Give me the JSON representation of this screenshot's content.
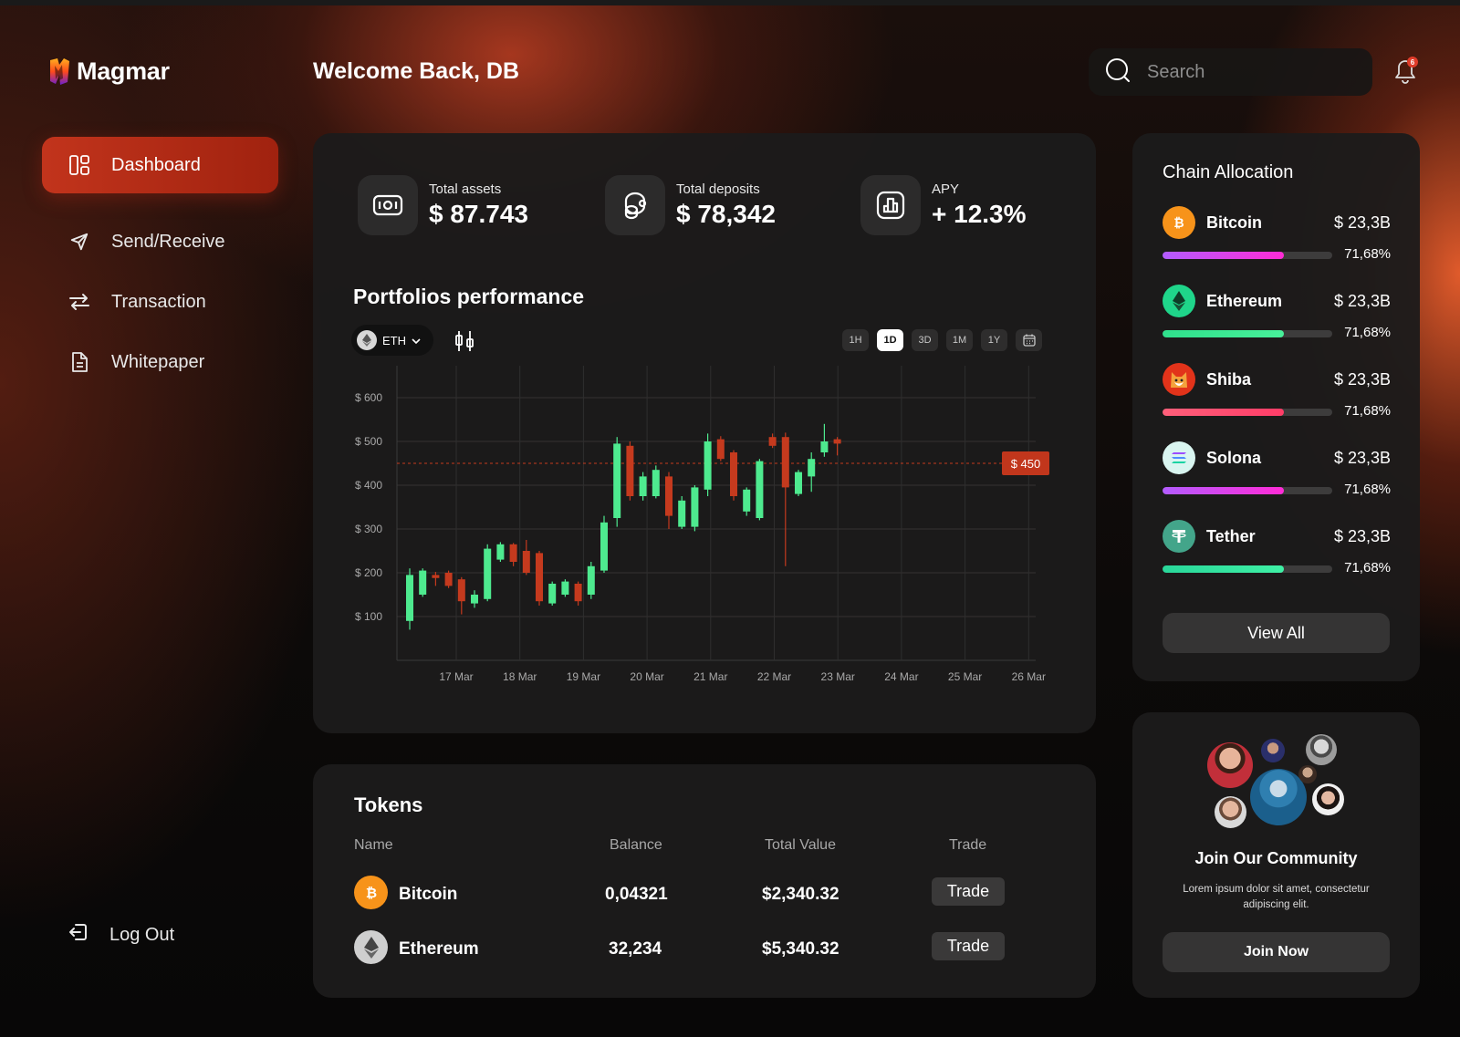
{
  "app": {
    "name": "Magmar"
  },
  "sidebar": {
    "items": [
      {
        "label": "Dashboard",
        "icon": "dashboard-icon",
        "active": true
      },
      {
        "label": "Send/Receive",
        "icon": "send-icon",
        "active": false
      },
      {
        "label": "Transaction",
        "icon": "transfer-arrows-icon",
        "active": false
      },
      {
        "label": "Whitepaper",
        "icon": "document-icon",
        "active": false
      }
    ],
    "logout": "Log Out"
  },
  "header": {
    "welcome": "Welcome Back, DB",
    "search_placeholder": "Search",
    "notification_count": "6"
  },
  "stats": [
    {
      "label": "Total assets",
      "value": "$ 87.743",
      "icon": "wallet-icon"
    },
    {
      "label": "Total deposits",
      "value": "$ 78,342",
      "icon": "coins-icon"
    },
    {
      "label": "APY",
      "value": "+ 12.3%",
      "icon": "bar-chart-icon"
    }
  ],
  "performance": {
    "title": "Portfolios performance",
    "asset": "ETH",
    "ranges": [
      "1H",
      "1D",
      "3D",
      "1M",
      "1Y"
    ],
    "active_range": "1D",
    "price_tag": "$ 450"
  },
  "chart_data": {
    "type": "candlestick",
    "title": "Portfolios performance",
    "y_ticks": [
      "$ 600",
      "$ 500",
      "$ 400",
      "$ 300",
      "$ 200",
      "$ 100"
    ],
    "y_tick_values": [
      600,
      500,
      400,
      300,
      200,
      100
    ],
    "ylim": [
      0,
      630
    ],
    "x_ticks": [
      "17 Mar",
      "18 Mar",
      "19 Mar",
      "20 Mar",
      "21 Mar",
      "22 Mar",
      "23 Mar",
      "24 Mar",
      "25 Mar",
      "26 Mar"
    ],
    "reference_line": 450,
    "up_color": "#4eea8f",
    "down_color": "#c53a1e",
    "candles": [
      {
        "o": 90,
        "c": 195,
        "h": 210,
        "l": 70
      },
      {
        "o": 150,
        "c": 205,
        "h": 210,
        "l": 145
      },
      {
        "o": 195,
        "c": 188,
        "h": 202,
        "l": 170
      },
      {
        "o": 200,
        "c": 170,
        "h": 205,
        "l": 165
      },
      {
        "o": 185,
        "c": 135,
        "h": 190,
        "l": 105
      },
      {
        "o": 130,
        "c": 150,
        "h": 160,
        "l": 120
      },
      {
        "o": 140,
        "c": 255,
        "h": 265,
        "l": 135
      },
      {
        "o": 230,
        "c": 265,
        "h": 270,
        "l": 225
      },
      {
        "o": 265,
        "c": 225,
        "h": 268,
        "l": 215
      },
      {
        "o": 250,
        "c": 200,
        "h": 275,
        "l": 195
      },
      {
        "o": 245,
        "c": 135,
        "h": 250,
        "l": 125
      },
      {
        "o": 130,
        "c": 175,
        "h": 180,
        "l": 125
      },
      {
        "o": 150,
        "c": 180,
        "h": 185,
        "l": 145
      },
      {
        "o": 175,
        "c": 135,
        "h": 180,
        "l": 125
      },
      {
        "o": 150,
        "c": 215,
        "h": 225,
        "l": 140
      },
      {
        "o": 205,
        "c": 315,
        "h": 330,
        "l": 200
      },
      {
        "o": 325,
        "c": 495,
        "h": 510,
        "l": 305
      },
      {
        "o": 490,
        "c": 375,
        "h": 500,
        "l": 365
      },
      {
        "o": 375,
        "c": 420,
        "h": 430,
        "l": 365
      },
      {
        "o": 375,
        "c": 435,
        "h": 445,
        "l": 370
      },
      {
        "o": 420,
        "c": 330,
        "h": 430,
        "l": 300
      },
      {
        "o": 305,
        "c": 365,
        "h": 375,
        "l": 300
      },
      {
        "o": 305,
        "c": 395,
        "h": 400,
        "l": 295
      },
      {
        "o": 390,
        "c": 500,
        "h": 518,
        "l": 375
      },
      {
        "o": 505,
        "c": 460,
        "h": 512,
        "l": 455
      },
      {
        "o": 475,
        "c": 375,
        "h": 480,
        "l": 365
      },
      {
        "o": 340,
        "c": 390,
        "h": 395,
        "l": 330
      },
      {
        "o": 325,
        "c": 455,
        "h": 460,
        "l": 320
      },
      {
        "o": 510,
        "c": 490,
        "h": 518,
        "l": 485
      },
      {
        "o": 510,
        "c": 395,
        "h": 520,
        "l": 215
      },
      {
        "o": 380,
        "c": 430,
        "h": 435,
        "l": 375
      },
      {
        "o": 420,
        "c": 460,
        "h": 475,
        "l": 385
      },
      {
        "o": 475,
        "c": 500,
        "h": 540,
        "l": 465
      },
      {
        "o": 505,
        "c": 495,
        "h": 510,
        "l": 468
      }
    ]
  },
  "tokens": {
    "title": "Tokens",
    "columns": [
      "Name",
      "Balance",
      "Total Value",
      "Trade"
    ],
    "rows": [
      {
        "name": "Bitcoin",
        "balance": "0,04321",
        "value": "$2,340.32",
        "trade": "Trade",
        "icon": "bitcoin-icon",
        "color": "#f7931a"
      },
      {
        "name": "Ethereum",
        "balance": "32,234",
        "value": "$5,340.32",
        "trade": "Trade",
        "icon": "ethereum-icon",
        "color": "#c9c9c9"
      }
    ]
  },
  "chain": {
    "title": "Chain Allocation",
    "items": [
      {
        "name": "Bitcoin",
        "amount": "$ 23,3B",
        "percent": "71,68%",
        "fill": 0.7168,
        "icon": "bitcoin-icon",
        "bar_from": "#b35cff",
        "bar_to": "#ff2bd6",
        "icon_bg": "#f7931a"
      },
      {
        "name": "Ethereum",
        "amount": "$ 23,3B",
        "percent": "71,68%",
        "fill": 0.7168,
        "icon": "ethereum-icon",
        "bar_from": "#2fe08c",
        "bar_to": "#48f09a",
        "icon_bg": "#1fd58a"
      },
      {
        "name": "Shiba",
        "amount": "$ 23,3B",
        "percent": "71,68%",
        "fill": 0.7168,
        "icon": "shiba-icon",
        "bar_from": "#ff5f7a",
        "bar_to": "#ff3d68",
        "icon_bg": "#e2331a"
      },
      {
        "name": "Solona",
        "amount": "$ 23,3B",
        "percent": "71,68%",
        "fill": 0.7168,
        "icon": "solana-icon",
        "bar_from": "#b35cff",
        "bar_to": "#ff2bd6",
        "icon_bg": "#d9f5f0"
      },
      {
        "name": "Tether",
        "amount": "$ 23,3B",
        "percent": "71,68%",
        "fill": 0.7168,
        "icon": "tether-icon",
        "bar_from": "#29d79a",
        "bar_to": "#3ff0a5",
        "icon_bg": "#43a58a"
      }
    ],
    "view_all": "View All"
  },
  "community": {
    "title": "Join Our Community",
    "text": "Lorem ipsum dolor sit amet, consectetur adipiscing elit.",
    "button": "Join Now"
  }
}
